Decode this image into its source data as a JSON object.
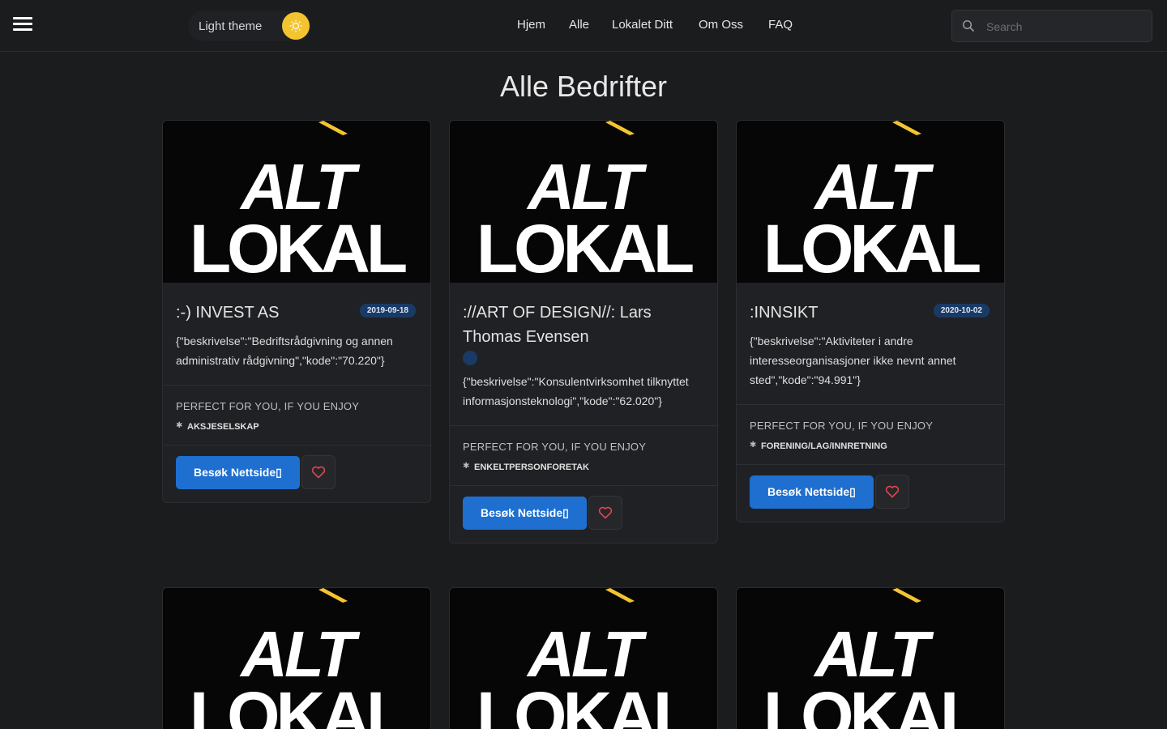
{
  "header": {
    "theme_label": "Light theme",
    "nav": [
      "Hjem",
      "Alle",
      "Lokalet Ditt",
      "Om Oss",
      "FAQ"
    ],
    "search_placeholder": "Search",
    "accent_color": "#f4c430"
  },
  "page_title": "Alle Bedrifter",
  "logo": {
    "line1": "ALT",
    "line2": "LOKAL"
  },
  "tags_label": "PERFECT FOR YOU, IF YOU ENJOY",
  "visit_label": "Besøk Nettside▯",
  "cards": [
    {
      "title": ":-) INVEST AS",
      "date": "2019-09-18",
      "description": "{\"beskrivelse\":\"Bedriftsrådgivning og annen administrativ rådgivning\",\"kode\":\"70.220\"}",
      "tag": "AKSJESELSKAP"
    },
    {
      "title": "://ART OF DESIGN//: Lars Thomas Evensen",
      "date": "",
      "description": "{\"beskrivelse\":\"Konsulentvirksomhet tilknyttet informasjonsteknologi\",\"kode\":\"62.020\"}",
      "tag": "ENKELTPERSONFORETAK"
    },
    {
      "title": ":INNSIKT",
      "date": "2020-10-02",
      "description": "{\"beskrivelse\":\"Aktiviteter i andre interesseorganisasjoner ikke nevnt annet sted\",\"kode\":\"94.991\"}",
      "tag": "FORENING/LAG/INNRETNING"
    }
  ],
  "colors": {
    "primary_button": "#1e6fd0",
    "heart": "#e0454f",
    "badge": "#1a3a66"
  }
}
